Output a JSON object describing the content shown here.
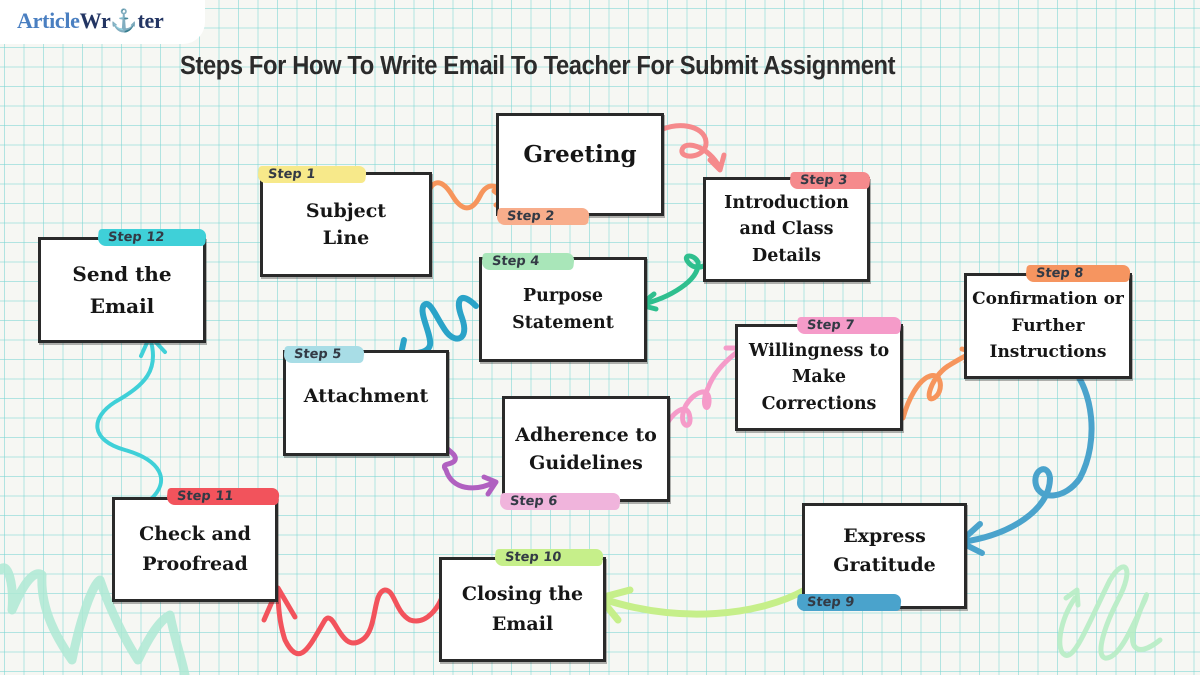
{
  "brand": {
    "logo_part1": "Article",
    "logo_part2": "Wr⚓ter",
    "logo_full": "ArticleWriter"
  },
  "title": "Steps For How To Write Email To Teacher For Submit Assignment",
  "colors": {
    "grid": "#78d6d2",
    "paper": "#f6f7f3",
    "box_border": "#2a2a2a",
    "step1": "#f7e98a",
    "step2": "#f8ad8b",
    "step3": "#f58a8c",
    "step4": "#a9e6b9",
    "step5": "#a8dde6",
    "step6": "#f0b4dc",
    "step7": "#f59bc9",
    "step8": "#f69560",
    "step9": "#4aa3cc",
    "step10": "#c6ef8a",
    "step11": "#f2535c",
    "step12": "#3fd0d8"
  },
  "steps": [
    {
      "number": 1,
      "tag": "Step 1",
      "label": "Subject Line"
    },
    {
      "number": 2,
      "tag": "Step 2",
      "label": "Greeting"
    },
    {
      "number": 3,
      "tag": "Step 3",
      "label": "Introduction and Class Details"
    },
    {
      "number": 4,
      "tag": "Step 4",
      "label": "Purpose Statement"
    },
    {
      "number": 5,
      "tag": "Step 5",
      "label": "Attachment"
    },
    {
      "number": 6,
      "tag": "Step 6",
      "label": "Adherence to Guidelines"
    },
    {
      "number": 7,
      "tag": "Step 7",
      "label": "Willingness to Make Corrections"
    },
    {
      "number": 8,
      "tag": "Step 8",
      "label": "Confirmation or Further Instructions"
    },
    {
      "number": 9,
      "tag": "Step 9",
      "label": "Express Gratitude"
    },
    {
      "number": 10,
      "tag": "Step 10",
      "label": "Closing the Email"
    },
    {
      "number": 11,
      "tag": "Step 11",
      "label": "Check and Proofread"
    },
    {
      "number": 12,
      "tag": "Step 12",
      "label": "Send the Email"
    }
  ],
  "connectors": [
    {
      "from": 1,
      "to": 2,
      "color": "#f6955c"
    },
    {
      "from": 2,
      "to": 3,
      "color": "#f58a8c"
    },
    {
      "from": 3,
      "to": 4,
      "color": "#2fbf8e"
    },
    {
      "from": 4,
      "to": 5,
      "color": "#2aa3c8"
    },
    {
      "from": 5,
      "to": 6,
      "color": "#b060c0"
    },
    {
      "from": 6,
      "to": 7,
      "color": "#f59bc9"
    },
    {
      "from": 7,
      "to": 8,
      "color": "#f6955c"
    },
    {
      "from": 8,
      "to": 9,
      "color": "#4aa3cc"
    },
    {
      "from": 9,
      "to": 10,
      "color": "#c6ef8a"
    },
    {
      "from": 10,
      "to": 11,
      "color": "#f2535c"
    },
    {
      "from": 11,
      "to": 12,
      "color": "#3fd0d8"
    }
  ]
}
